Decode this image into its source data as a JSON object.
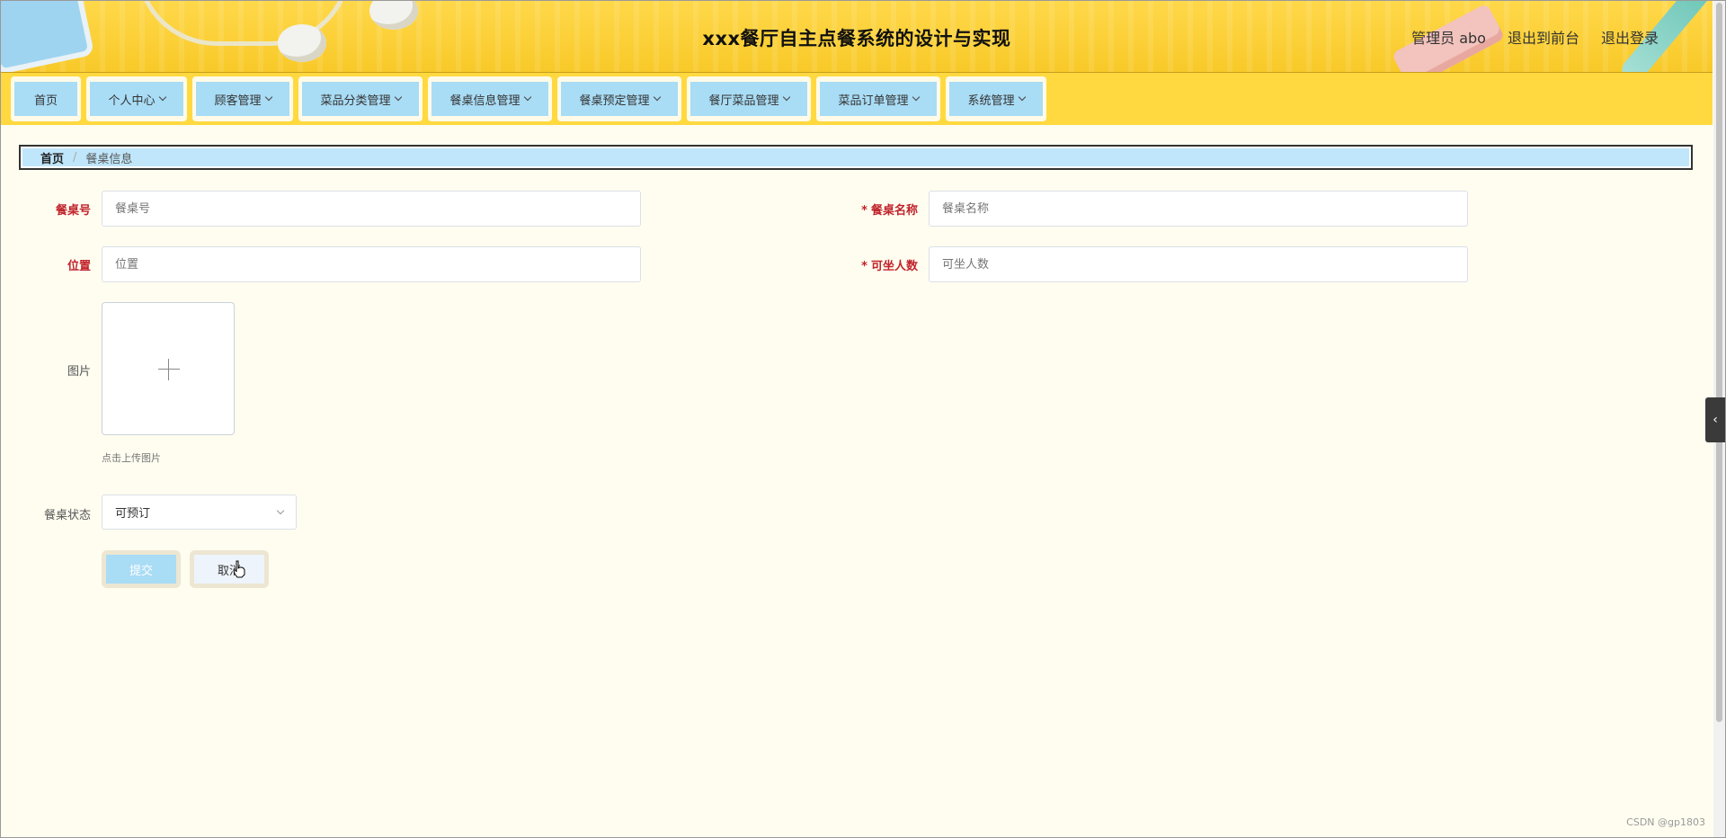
{
  "header": {
    "title": "xxx餐厅自主点餐系统的设计与实现",
    "admin_label": "管理员 abo",
    "front_link": "退出到前台",
    "logout_link": "退出登录"
  },
  "nav": {
    "items": [
      {
        "label": "首页",
        "dropdown": false
      },
      {
        "label": "个人中心",
        "dropdown": true
      },
      {
        "label": "顾客管理",
        "dropdown": true
      },
      {
        "label": "菜品分类管理",
        "dropdown": true
      },
      {
        "label": "餐桌信息管理",
        "dropdown": true
      },
      {
        "label": "餐桌预定管理",
        "dropdown": true
      },
      {
        "label": "餐厅菜品管理",
        "dropdown": true
      },
      {
        "label": "菜品订单管理",
        "dropdown": true
      },
      {
        "label": "系统管理",
        "dropdown": true
      }
    ]
  },
  "breadcrumb": {
    "home": "首页",
    "separator": "/",
    "current": "餐桌信息"
  },
  "form": {
    "table_no": {
      "label": "餐桌号",
      "placeholder": "餐桌号",
      "value": ""
    },
    "table_name": {
      "required_mark": "*",
      "label": "餐桌名称",
      "placeholder": "餐桌名称",
      "value": ""
    },
    "location": {
      "label": "位置",
      "placeholder": "位置",
      "value": ""
    },
    "seats": {
      "required_mark": "*",
      "label": "可坐人数",
      "placeholder": "可坐人数",
      "value": ""
    },
    "image": {
      "label": "图片",
      "hint": "点击上传图片"
    },
    "status": {
      "label": "餐桌状态",
      "value": "可预订"
    },
    "submit_label": "提交",
    "cancel_label": "取消"
  },
  "watermark": "CSDN @gp1803",
  "colors": {
    "header_yellow": "#ffd84a",
    "nav_button_blue": "#a9dcf5",
    "required_red": "#c0232b",
    "page_bg": "#fffdf0"
  },
  "icons": {
    "upload": "plus-icon",
    "dropdown": "chevron-down-icon",
    "side_tab": "chevron-left-icon"
  }
}
